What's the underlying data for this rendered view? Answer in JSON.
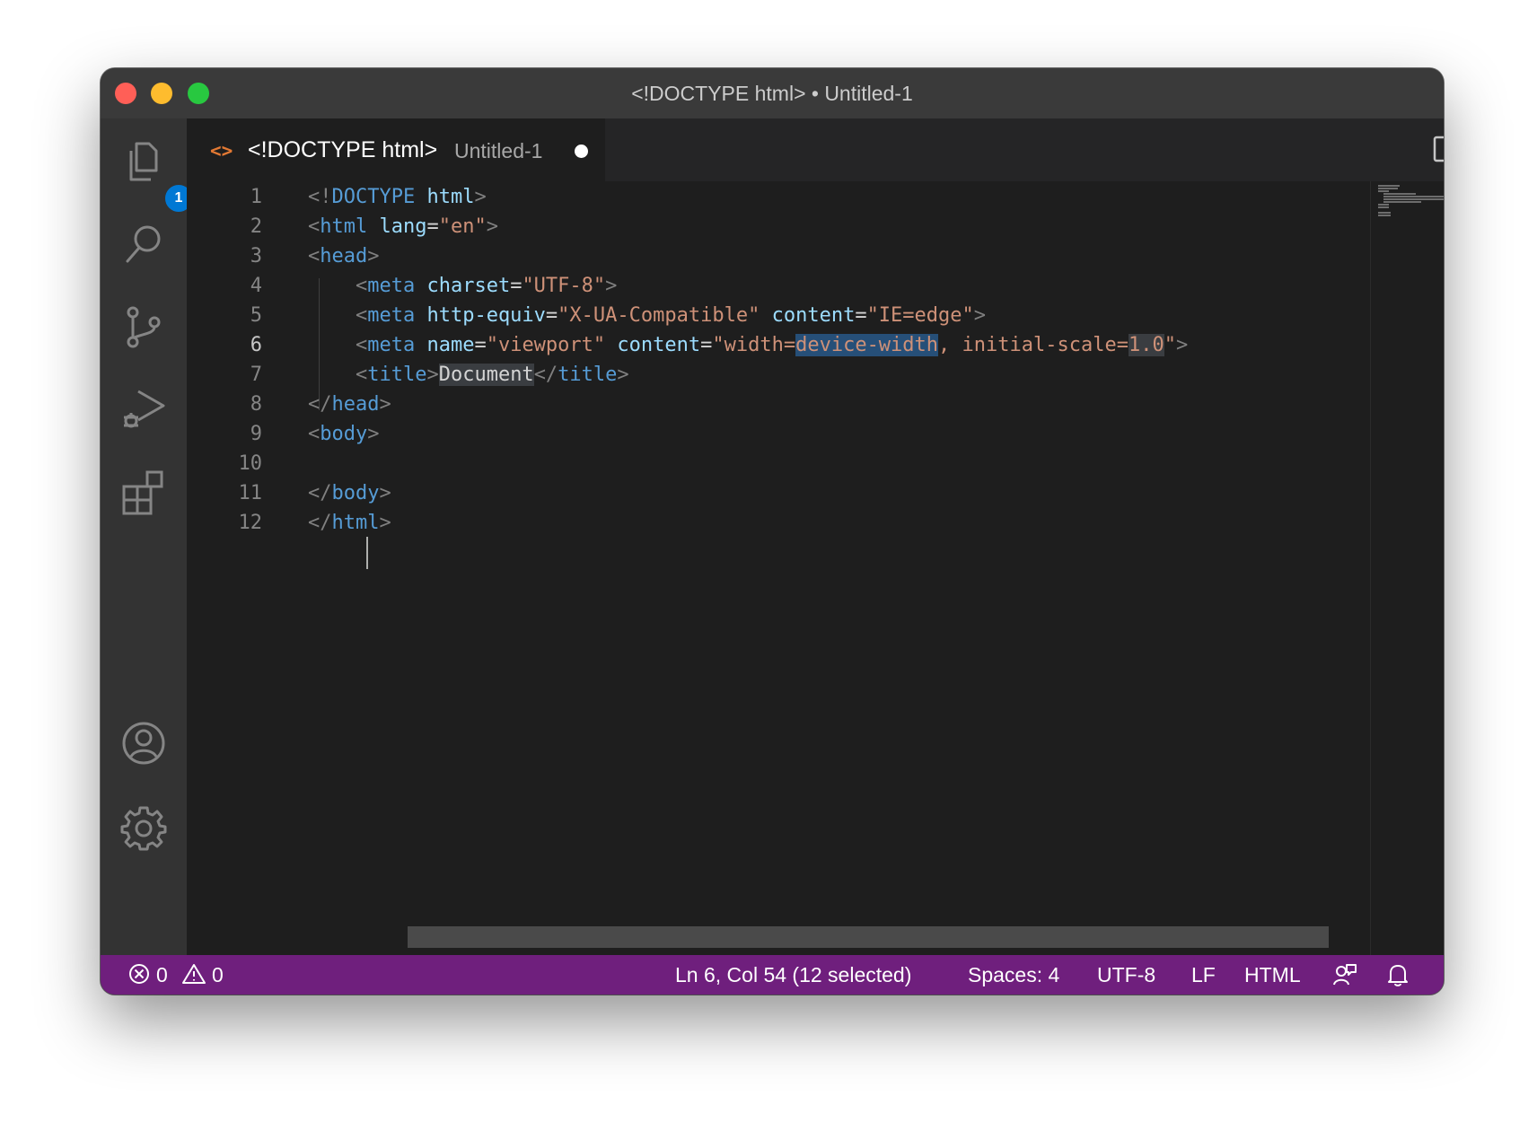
{
  "window": {
    "title": "<!DOCTYPE html> • Untitled-1"
  },
  "activity_bar": {
    "items": [
      {
        "icon": "explorer-icon",
        "badge": "1"
      },
      {
        "icon": "search-icon"
      },
      {
        "icon": "source-control-icon"
      },
      {
        "icon": "run-debug-icon"
      },
      {
        "icon": "extensions-icon"
      },
      {
        "icon": "account-icon"
      },
      {
        "icon": "settings-gear-icon"
      }
    ]
  },
  "tab": {
    "icon": "html-file-icon",
    "icon_glyph": "<>",
    "name": "<!DOCTYPE html>",
    "description": "Untitled-1",
    "dirty": true
  },
  "editor": {
    "active_line": 6,
    "lines": [
      [
        {
          "c": "p",
          "t": "<!"
        },
        {
          "c": "t",
          "t": "DOCTYPE"
        },
        {
          "c": "x",
          "t": " "
        },
        {
          "c": "a",
          "t": "html"
        },
        {
          "c": "p",
          "t": ">"
        }
      ],
      [
        {
          "c": "p",
          "t": "<"
        },
        {
          "c": "t",
          "t": "html"
        },
        {
          "c": "x",
          "t": " "
        },
        {
          "c": "a",
          "t": "lang"
        },
        {
          "c": "x",
          "t": "="
        },
        {
          "c": "s",
          "t": "\"en\""
        },
        {
          "c": "p",
          "t": ">"
        }
      ],
      [
        {
          "c": "p",
          "t": "<"
        },
        {
          "c": "t",
          "t": "head"
        },
        {
          "c": "p",
          "t": ">"
        }
      ],
      [
        {
          "c": "x",
          "t": "    "
        },
        {
          "c": "p",
          "t": "<"
        },
        {
          "c": "t",
          "t": "meta"
        },
        {
          "c": "x",
          "t": " "
        },
        {
          "c": "a",
          "t": "charset"
        },
        {
          "c": "x",
          "t": "="
        },
        {
          "c": "s",
          "t": "\"UTF-8\""
        },
        {
          "c": "p",
          "t": ">"
        }
      ],
      [
        {
          "c": "x",
          "t": "    "
        },
        {
          "c": "p",
          "t": "<"
        },
        {
          "c": "t",
          "t": "meta"
        },
        {
          "c": "x",
          "t": " "
        },
        {
          "c": "a",
          "t": "http-equiv"
        },
        {
          "c": "x",
          "t": "="
        },
        {
          "c": "s",
          "t": "\"X-UA-Compatible\""
        },
        {
          "c": "x",
          "t": " "
        },
        {
          "c": "a",
          "t": "content"
        },
        {
          "c": "x",
          "t": "="
        },
        {
          "c": "s",
          "t": "\"IE=edge\""
        },
        {
          "c": "p",
          "t": ">"
        }
      ],
      [
        {
          "c": "x",
          "t": "    "
        },
        {
          "c": "p",
          "t": "<"
        },
        {
          "c": "t",
          "t": "meta"
        },
        {
          "c": "x",
          "t": " "
        },
        {
          "c": "a",
          "t": "name"
        },
        {
          "c": "x",
          "t": "="
        },
        {
          "c": "s",
          "t": "\"viewport\""
        },
        {
          "c": "x",
          "t": " "
        },
        {
          "c": "a",
          "t": "content"
        },
        {
          "c": "x",
          "t": "="
        },
        {
          "c": "s",
          "t": "\"width="
        },
        {
          "c": "s sel",
          "t": "device-width"
        },
        {
          "c": "s",
          "t": ", initial-scale="
        },
        {
          "c": "s hl",
          "t": "1.0"
        },
        {
          "c": "s",
          "t": "\""
        },
        {
          "c": "p",
          "t": ">"
        }
      ],
      [
        {
          "c": "x",
          "t": "    "
        },
        {
          "c": "p",
          "t": "<"
        },
        {
          "c": "t",
          "t": "title"
        },
        {
          "c": "p",
          "t": ">"
        },
        {
          "c": "x hl",
          "t": "Document"
        },
        {
          "c": "p",
          "t": "</"
        },
        {
          "c": "t",
          "t": "title"
        },
        {
          "c": "p",
          "t": ">"
        }
      ],
      [
        {
          "c": "p",
          "t": "</"
        },
        {
          "c": "t",
          "t": "head"
        },
        {
          "c": "p",
          "t": ">"
        }
      ],
      [
        {
          "c": "p",
          "t": "<"
        },
        {
          "c": "t",
          "t": "body"
        },
        {
          "c": "p",
          "t": ">"
        }
      ],
      [
        {
          "c": "x",
          "t": ""
        }
      ],
      [
        {
          "c": "p",
          "t": "</"
        },
        {
          "c": "t",
          "t": "body"
        },
        {
          "c": "p",
          "t": ">"
        }
      ],
      [
        {
          "c": "p",
          "t": "</"
        },
        {
          "c": "t",
          "t": "html"
        },
        {
          "c": "p",
          "t": ">"
        }
      ]
    ]
  },
  "status_bar": {
    "errors": "0",
    "warnings": "0",
    "cursor": "Ln 6, Col 54 (12 selected)",
    "indentation": "Spaces: 4",
    "encoding": "UTF-8",
    "eol": "LF",
    "language": "HTML"
  },
  "colors": {
    "status_bar": "#6f1f7d",
    "badge": "#0078d4",
    "tag": "#569cd6",
    "attribute": "#9cdcfe",
    "string": "#ce9178",
    "selection": "#264f78"
  }
}
